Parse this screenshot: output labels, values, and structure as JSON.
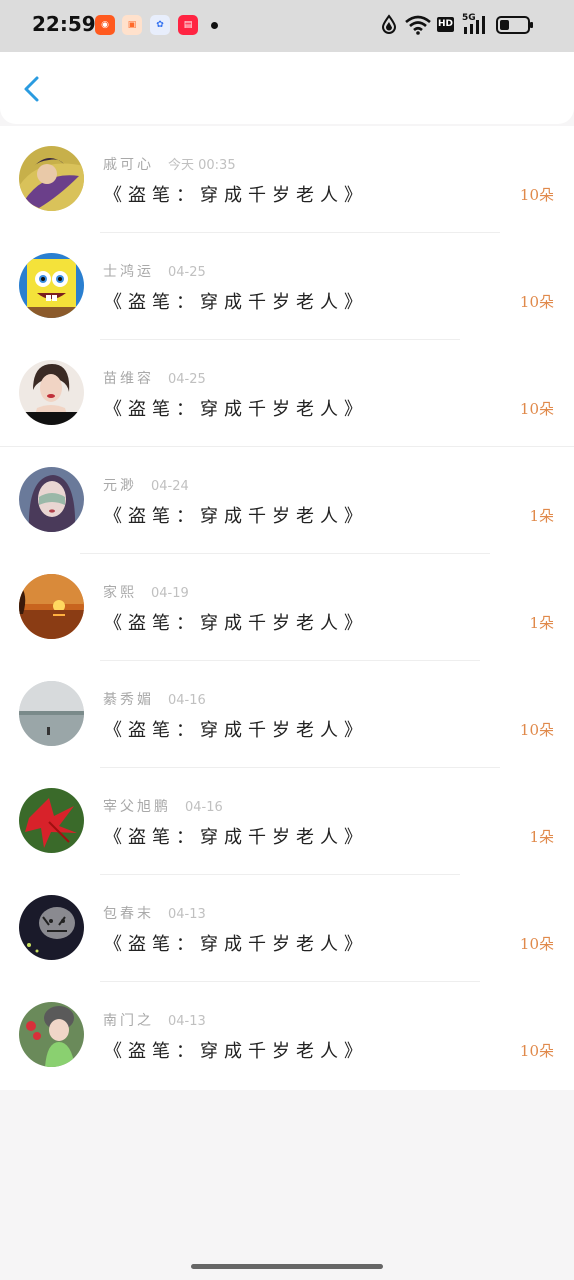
{
  "status_bar": {
    "time": "22:59",
    "app_icons": [
      {
        "name": "kuaishou-app-icon",
        "color": "#ff5a1f",
        "glyph": "◉"
      },
      {
        "name": "game-app-icon",
        "color": "#ff8a3d",
        "glyph": "▣"
      },
      {
        "name": "baidu-app-icon",
        "color": "#2f6ff0",
        "glyph": "✿"
      },
      {
        "name": "xiaohongshu-app-icon",
        "color": "#ff2442",
        "glyph": "▤"
      }
    ],
    "hd_label": "HD",
    "network_label": "5G"
  },
  "header": {
    "back_icon": "chevron-left-icon",
    "accent_color": "#2a9be0"
  },
  "list": {
    "book_title": "《盗笔：穿成千岁老人》",
    "items": [
      {
        "name": "戚可心",
        "date": "今天 00:35",
        "count": "10朵",
        "avatar": "fantasy-woman"
      },
      {
        "name": "士鸿运",
        "date": "04-25",
        "count": "10朵",
        "avatar": "spongebob"
      },
      {
        "name": "苗维容",
        "date": "04-25",
        "count": "10朵",
        "avatar": "woman-portrait"
      },
      {
        "name": "元渺",
        "date": "04-24",
        "count": "1朵",
        "avatar": "masked-girl"
      },
      {
        "name": "家熙",
        "date": "04-19",
        "count": "1朵",
        "avatar": "sunset"
      },
      {
        "name": "綦秀媚",
        "date": "04-16",
        "count": "10朵",
        "avatar": "lake"
      },
      {
        "name": "宰父旭鹏",
        "date": "04-16",
        "count": "1朵",
        "avatar": "red-leaves"
      },
      {
        "name": "包春末",
        "date": "04-13",
        "count": "10朵",
        "avatar": "tiger"
      },
      {
        "name": "南门之",
        "date": "04-13",
        "count": "10朵",
        "avatar": "girl-beanie"
      }
    ]
  },
  "colors": {
    "count_color": "#e0894a",
    "name_color": "#a9a9a9",
    "title_color": "#222222"
  }
}
